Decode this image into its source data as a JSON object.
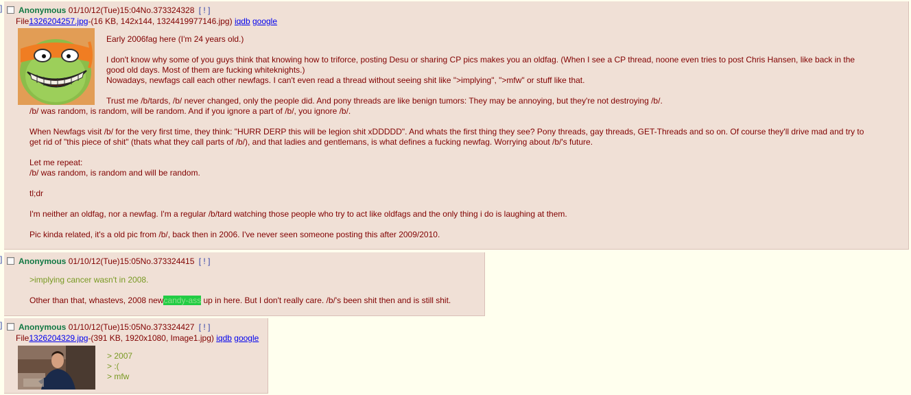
{
  "posts": [
    {
      "name": "Anonymous",
      "datetime": "01/10/12(Tue)15:04",
      "number": "No.373324328",
      "quote_btn": "[ ! ]",
      "file_prefix": "File",
      "file_link": "1326204257.jpg",
      "file_info": "-(16 KB, 142x144, 1324419977146.jpg)",
      "iqdb": "iqdb",
      "google": "google",
      "lines": [
        "Early 2006fag here (I'm 24 years old.)",
        "I don't know why some of you guys think that knowing how to triforce, posting Desu or sharing CP pics makes you an oldfag. (When I see a CP thread, noone even tries to post Chris Hansen, like back in the",
        "good old days. Most of them are fucking whiteknights.)",
        "Nowadays, newfags call each other newfags. I can't even read a thread without seeing shit like \">implying\", \">mfw\" or stuff like that.",
        "Trust me /b/tards, /b/ never changed, only the people did. And pony threads are like benign tumors: They may be annoying, but they're not destroying /b/.",
        "/b/ was random, is random, will be random. And if you ignore a part of /b/, you ignore /b/.",
        "When Newfags visit /b/ for the very first time, they think: \"HURR DERP this will be legion shit xDDDDD\". And whats the first thing they see? Pony threads, gay threads, GET-Threads and so on. Of course they'll drive mad and try to",
        "get rid of \"this piece of shit\" (thats what they call parts of /b/), and that ladies and gentlemans, is what defines a fucking newfag. Worrying about /b/'s future.",
        "Let me repeat:",
        "/b/ was random, is random and will be random.",
        "tl;dr",
        "I'm neither an oldfag, nor a newfag. I'm a regular /b/tard watching those people who try to act like oldfags and the only thing i do is laughing at them.",
        "Pic kinda related, it's a old pic from /b/, back then in 2006. I've never seen someone posting this after 2009/2010."
      ]
    },
    {
      "name": "Anonymous",
      "datetime": "01/10/12(Tue)15:05",
      "number": "No.373324415",
      "quote_btn": "[ ! ]",
      "greentext": ">implying cancer wasn't in 2008.",
      "text_before": "Other than that, whastevs, 2008 new",
      "highlight": "candy-ass",
      "text_after": " up in here. But I don't really care. /b/'s been shit then and is still shit."
    },
    {
      "name": "Anonymous",
      "datetime": "01/10/12(Tue)15:05",
      "number": "No.373324427",
      "quote_btn": "[ ! ]",
      "file_prefix": "File",
      "file_link": "1326204329.jpg",
      "file_info": "-(391 KB, 1920x1080, Image1.jpg)",
      "iqdb": "iqdb",
      "google": "google",
      "greentext": [
        "> 2007",
        "> :(",
        "> mfw"
      ]
    }
  ],
  "colors": {
    "post_bg": "#f0e0d6",
    "page_bg": "#ffffee",
    "name": "#117743",
    "text": "#800000",
    "greentext": "#789922",
    "link": "#0000ee"
  }
}
